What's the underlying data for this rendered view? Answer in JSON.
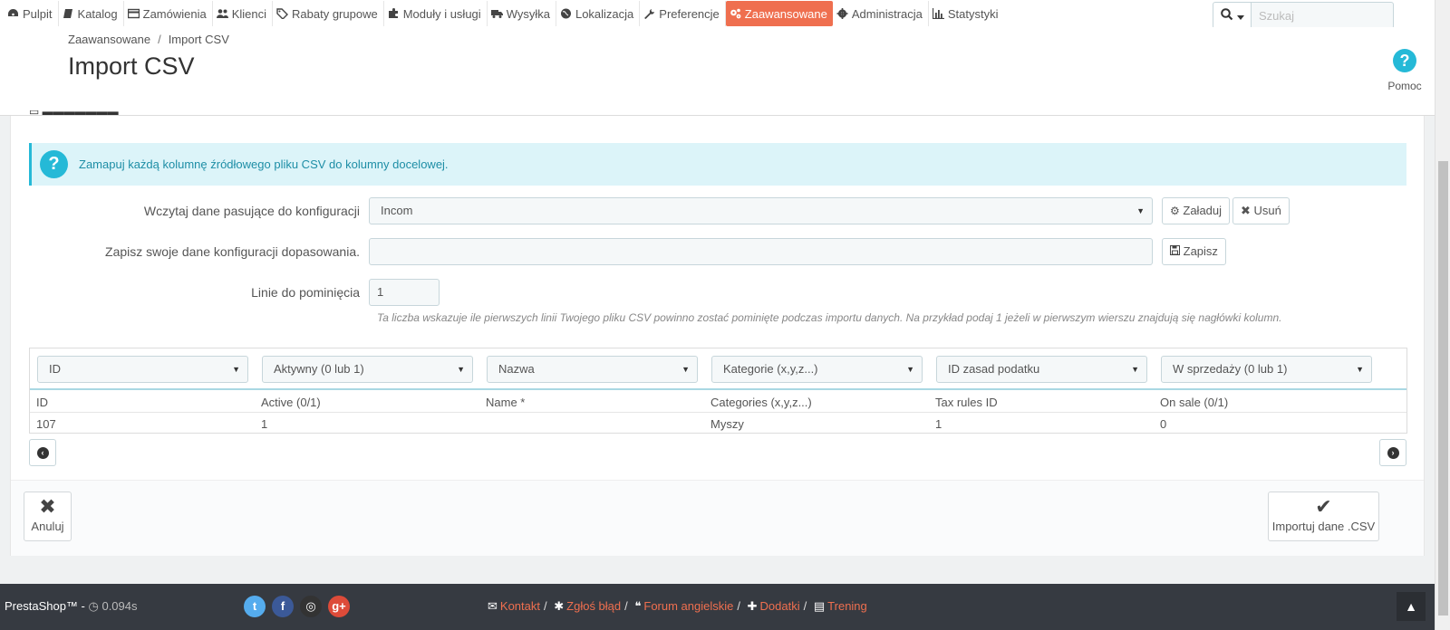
{
  "nav": {
    "items": [
      {
        "label": "Pulpit",
        "icon": "dashboard-icon"
      },
      {
        "label": "Katalog",
        "icon": "book-icon"
      },
      {
        "label": "Zamówienia",
        "icon": "credit-card-icon"
      },
      {
        "label": "Klienci",
        "icon": "users-icon"
      },
      {
        "label": "Rabaty grupowe",
        "icon": "tags-icon"
      },
      {
        "label": "Moduły i usługi",
        "icon": "puzzle-icon"
      },
      {
        "label": "Wysyłka",
        "icon": "truck-icon"
      },
      {
        "label": "Lokalizacja",
        "icon": "globe-icon"
      },
      {
        "label": "Preferencje",
        "icon": "wrench-icon"
      },
      {
        "label": "Zaawansowane",
        "icon": "cogs-icon",
        "active": true
      },
      {
        "label": "Administracja",
        "icon": "cog-icon"
      },
      {
        "label": "Statystyki",
        "icon": "bar-chart-icon"
      }
    ],
    "active_color": "#ef6f4f"
  },
  "search": {
    "placeholder": "Szukaj"
  },
  "breadcrumb": {
    "parent": "Zaawansowane",
    "sep": "/",
    "current": "Import CSV"
  },
  "page_title": "Import CSV",
  "help_label": "Pomoc",
  "alert": {
    "text": "Zamapuj każdą kolumnę źródłowego pliku CSV do kolumny docelowej."
  },
  "form": {
    "load_label": "Wczytaj dane pasujące do konfiguracji",
    "load_value": "Incom",
    "load_button": "Załaduj",
    "delete_button": "Usuń",
    "save_label": "Zapisz swoje dane konfiguracji dopasowania.",
    "save_input": "",
    "save_button": "Zapisz",
    "skip_label": "Linie do pominięcia",
    "skip_value": "1",
    "skip_hint": "Ta liczba wskazuje ile pierwszych linii Twojego pliku CSV powinno zostać pominięte podczas importu danych. Na przykład podaj 1 jeżeli w pierwszym wierszu znajdują się nagłówki kolumn."
  },
  "mapping": {
    "selects": [
      "ID",
      "Aktywny (0 lub 1)",
      "Nazwa",
      "Kategorie (x,y,z...)",
      "ID zasad podatku",
      "W sprzedaży (0 lub 1)"
    ],
    "headers": [
      "ID",
      "Active (0/1)",
      "Name *",
      "Categories (x,y,z...)",
      "Tax rules ID",
      "On sale (0/1)"
    ],
    "row": [
      "107",
      "1",
      "",
      "Myszy",
      "1",
      "0"
    ]
  },
  "footer_buttons": {
    "cancel": "Anuluj",
    "import": "Importuj dane .CSV"
  },
  "footer": {
    "brand": "PrestaShop™",
    "dash": " - ",
    "time": "0.094s",
    "links": [
      "Kontakt",
      "Zgłoś błąd",
      "Forum angielskie",
      "Dodatki",
      "Trening"
    ],
    "link_sep": "/",
    "social_colors": {
      "twitter": "#55acee",
      "facebook": "#3b5998",
      "github": "#333333",
      "google": "#dd4b39"
    }
  }
}
